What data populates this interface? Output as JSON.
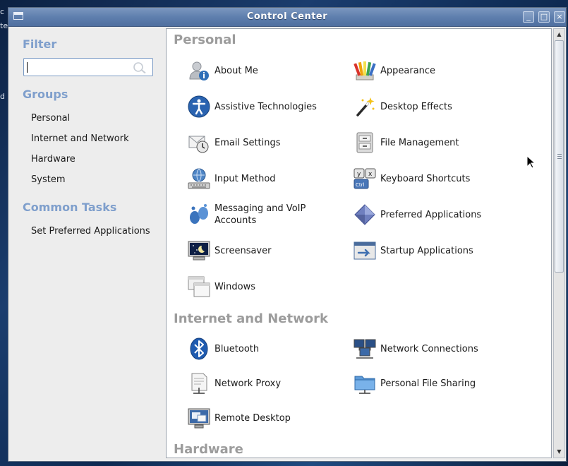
{
  "desktop": {
    "edge_glyphs": [
      "c",
      "ter",
      "d"
    ]
  },
  "window": {
    "title": "Control Center",
    "controls": {
      "minimize": "_",
      "maximize": "□",
      "close": "×"
    }
  },
  "sidebar": {
    "filter_heading": "Filter",
    "search": {
      "value": "",
      "placeholder": ""
    },
    "groups_heading": "Groups",
    "groups": [
      "Personal",
      "Internet and Network",
      "Hardware",
      "System"
    ],
    "tasks_heading": "Common Tasks",
    "tasks": [
      "Set Preferred Applications"
    ]
  },
  "categories": [
    {
      "title": "Personal",
      "items": [
        {
          "label": "About Me",
          "icon": "about-me-icon"
        },
        {
          "label": "Appearance",
          "icon": "appearance-icon"
        },
        {
          "label": "Assistive Technologies",
          "icon": "assistive-technologies-icon"
        },
        {
          "label": "Desktop Effects",
          "icon": "desktop-effects-icon"
        },
        {
          "label": "Email Settings",
          "icon": "email-settings-icon"
        },
        {
          "label": "File Management",
          "icon": "file-management-icon"
        },
        {
          "label": "Input Method",
          "icon": "input-method-icon"
        },
        {
          "label": "Keyboard Shortcuts",
          "icon": "keyboard-shortcuts-icon"
        },
        {
          "label": "Messaging and VoIP Accounts",
          "icon": "messaging-icon"
        },
        {
          "label": "Preferred Applications",
          "icon": "preferred-applications-icon"
        },
        {
          "label": "Screensaver",
          "icon": "screensaver-icon"
        },
        {
          "label": "Startup Applications",
          "icon": "startup-applications-icon"
        },
        {
          "label": "Windows",
          "icon": "windows-icon"
        }
      ]
    },
    {
      "title": "Internet and Network",
      "items": [
        {
          "label": "Bluetooth",
          "icon": "bluetooth-icon"
        },
        {
          "label": "Network Connections",
          "icon": "network-connections-icon"
        },
        {
          "label": "Network Proxy",
          "icon": "network-proxy-icon"
        },
        {
          "label": "Personal File Sharing",
          "icon": "file-sharing-icon"
        },
        {
          "label": "Remote Desktop",
          "icon": "remote-desktop-icon"
        }
      ]
    },
    {
      "title": "Hardware",
      "items": []
    }
  ]
}
